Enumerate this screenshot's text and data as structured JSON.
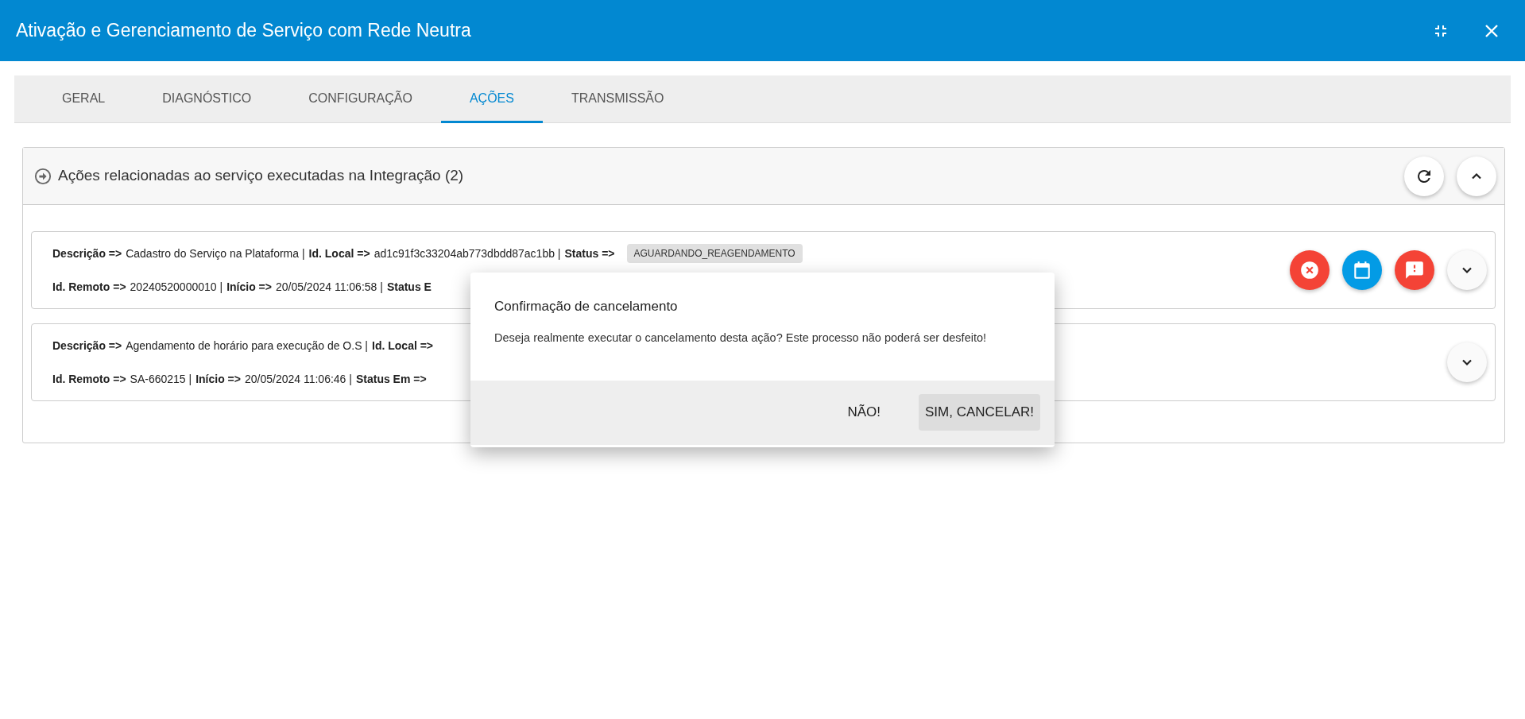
{
  "window": {
    "title": "Ativação e Gerenciamento de Serviço com Rede Neutra",
    "controls": [
      {
        "kind": "minimize"
      },
      {
        "kind": "close"
      }
    ]
  },
  "tabs": [
    {
      "label": "GERAL",
      "selected": false
    },
    {
      "label": "DIAGNÓSTICO",
      "selected": false
    },
    {
      "label": "CONFIGURAÇÃO",
      "selected": false
    },
    {
      "label": "AÇÕES",
      "selected": true
    },
    {
      "label": "TRANSMISSÃO",
      "selected": false
    }
  ],
  "panel": {
    "title": "Ações relacionadas ao serviço executadas na Integração (2)",
    "actions": [
      {
        "kind": "refresh"
      },
      {
        "kind": "collapse"
      }
    ],
    "rows": [
      {
        "lines": [
          [
            {
              "kind": "label",
              "text": "Descrição =>"
            },
            {
              "kind": "text",
              "text": "Cadastro do Serviço na Plataforma |"
            },
            {
              "kind": "label",
              "text": "Id. Local =>"
            },
            {
              "kind": "text",
              "text": "ad1c91f3c33204ab773dbdd87ac1bb |"
            },
            {
              "kind": "label",
              "text": "Status =>"
            },
            {
              "kind": "badge",
              "text": "AGUARDANDO_REAGENDAMENTO"
            }
          ],
          [
            {
              "kind": "label",
              "text": "Id. Remoto =>"
            },
            {
              "kind": "text",
              "text": "20240520000010 |"
            },
            {
              "kind": "label",
              "text": "Início =>"
            },
            {
              "kind": "text",
              "text": "20/05/2024 11:06:58 |"
            },
            {
              "kind": "label",
              "text": "Status E"
            }
          ]
        ],
        "actions": [
          {
            "kind": "cancel"
          },
          {
            "kind": "schedule"
          },
          {
            "kind": "alert"
          },
          {
            "kind": "expand"
          }
        ]
      },
      {
        "lines": [
          [
            {
              "kind": "label",
              "text": "Descrição =>"
            },
            {
              "kind": "text",
              "text": "Agendamento de horário para execução de O.S |"
            },
            {
              "kind": "label",
              "text": "Id. Local =>"
            }
          ],
          [
            {
              "kind": "label",
              "text": "Id. Remoto =>"
            },
            {
              "kind": "text",
              "text": "SA-660215 |"
            },
            {
              "kind": "label",
              "text": "Início =>"
            },
            {
              "kind": "text",
              "text": "20/05/2024 11:06:46 |"
            },
            {
              "kind": "label",
              "text": "Status Em =>"
            }
          ]
        ],
        "actions": [
          {
            "kind": "expand"
          }
        ]
      }
    ]
  },
  "dialog": {
    "title": "Confirmação de cancelamento",
    "message": "Deseja realmente executar o cancelamento desta ação? Este processo não poderá ser desfeito!",
    "buttons": [
      {
        "label": "NÃO!",
        "kind": "flat"
      },
      {
        "label": "SIM, CANCELAR!",
        "kind": "raised"
      }
    ]
  }
}
